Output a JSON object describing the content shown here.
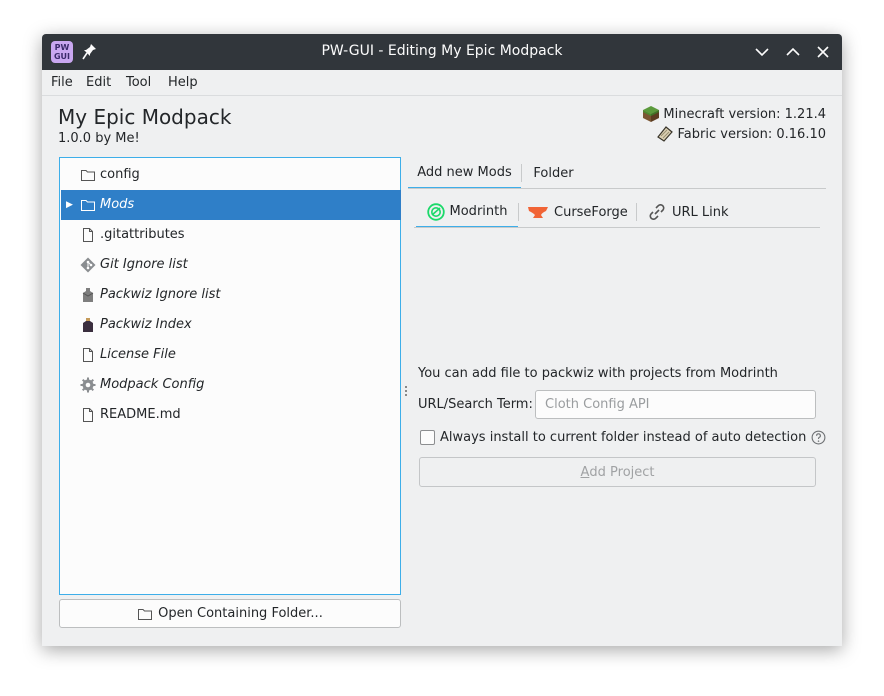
{
  "window": {
    "title": "PW-GUI - Editing My Epic Modpack",
    "logo_text_top": "PW",
    "logo_text_bottom": "GUI"
  },
  "menu": [
    "File",
    "Edit",
    "Tool",
    "Help"
  ],
  "modpack": {
    "name": "My Epic Modpack",
    "version_author": "1.0.0 by Me!",
    "minecraft_version": "Minecraft version: 1.21.4",
    "fabric_version": "Fabric version: 0.16.10"
  },
  "tree": [
    {
      "label": "config",
      "icon": "folder-icon",
      "italic": false,
      "selected": false
    },
    {
      "label": "Mods",
      "icon": "folder-icon",
      "italic": true,
      "selected": true,
      "expandable": true
    },
    {
      "label": ".gitattributes",
      "icon": "file-icon",
      "italic": false,
      "selected": false
    },
    {
      "label": "Git Ignore list",
      "icon": "git-icon",
      "italic": true,
      "selected": false
    },
    {
      "label": "Packwiz Ignore list",
      "icon": "packwiz-ignore-icon",
      "italic": true,
      "selected": false
    },
    {
      "label": "Packwiz Index",
      "icon": "packwiz-index-icon",
      "italic": true,
      "selected": false
    },
    {
      "label": "License File",
      "icon": "file-icon",
      "italic": true,
      "selected": false
    },
    {
      "label": "Modpack Config",
      "icon": "gear-icon",
      "italic": true,
      "selected": false
    },
    {
      "label": "README.md",
      "icon": "file-icon",
      "italic": false,
      "selected": false
    }
  ],
  "open_folder_button": "Open Containing Folder...",
  "tabs": [
    "Add new Mods",
    "Folder"
  ],
  "subtabs": [
    "Modrinth",
    "CurseForge",
    "URL Link"
  ],
  "modrinth": {
    "description": "You can add file to packwiz with projects from Modrinth",
    "url_label": "URL/Search Term:",
    "url_placeholder": "Cloth Config API",
    "url_value": "",
    "checkbox_label": "Always install to current folder instead of auto detection",
    "add_button_first": "A",
    "add_button_rest": "dd Project"
  },
  "colors": {
    "accent": "#3daee9",
    "selection": "#2f7fc8",
    "titlebar": "#31363b",
    "modrinth": "#1bd96a",
    "curseforge": "#f16436"
  }
}
